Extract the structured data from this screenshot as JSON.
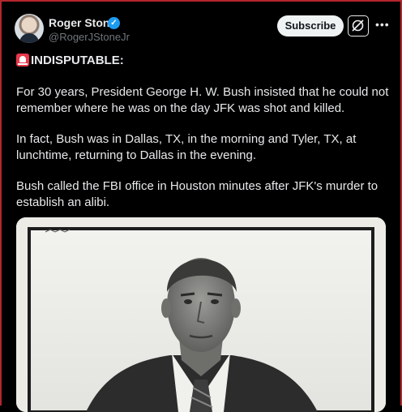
{
  "author": {
    "display_name": "Roger Stone",
    "handle": "@RogerJStoneJr"
  },
  "actions": {
    "subscribe_label": "Subscribe"
  },
  "icons": {
    "verified": "verified-badge-icon",
    "grok": "grok-icon",
    "more": "more-icon",
    "siren": "siren-emoji-icon"
  },
  "post": {
    "headline": "INDISPUTABLE:",
    "paragraphs": [
      "For 30 years, President George H. W. Bush insisted that he could not remember where he was on the day JFK was shot and killed.",
      "In fact, Bush was in Dallas, TX, in the morning and Tyler, TX, at lunchtime, returning to Dallas in the evening.",
      "Bush called the FBI office in Houston minutes after JFK's murder to establish an alibi."
    ]
  },
  "colors": {
    "accent": "#1d9bf0",
    "background": "#000000",
    "frame": "#b3262d"
  }
}
